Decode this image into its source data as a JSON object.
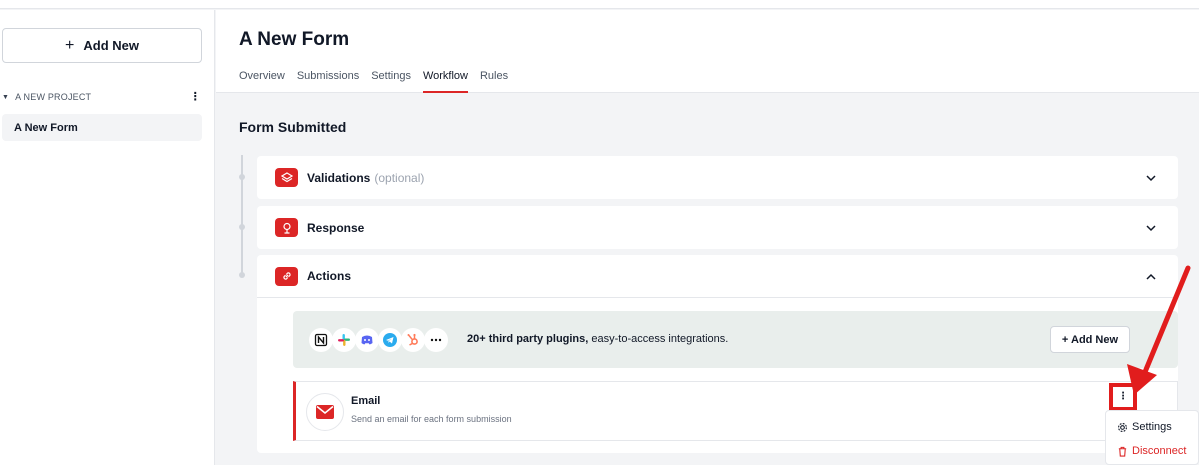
{
  "sidebar": {
    "add_new_label": "Add New",
    "project_name": "A NEW PROJECT",
    "forms": [
      {
        "label": "A New Form"
      }
    ]
  },
  "header": {
    "title": "A New Form",
    "tabs": [
      {
        "label": "Overview"
      },
      {
        "label": "Submissions"
      },
      {
        "label": "Settings"
      },
      {
        "label": "Workflow",
        "active": true
      },
      {
        "label": "Rules"
      }
    ]
  },
  "main": {
    "section_title": "Form Submitted",
    "panels": [
      {
        "label": "Validations",
        "optional": "(optional)"
      },
      {
        "label": "Response"
      },
      {
        "label": "Actions"
      }
    ],
    "plugins": {
      "icons": [
        "notion-icon",
        "slack-icon",
        "discord-icon",
        "telegram-icon",
        "hubspot-icon",
        "more-icon"
      ],
      "highlight": "20+ third party plugins,",
      "text": "easy-to-access integrations.",
      "add_label": "+ Add New"
    },
    "email_action": {
      "title": "Email",
      "description": "Send an email for each form submission"
    }
  },
  "context_menu": {
    "items": [
      {
        "label": "Settings",
        "icon": "gear-icon"
      },
      {
        "label": "Disconnect",
        "icon": "trash-icon"
      }
    ]
  },
  "colors": {
    "accent": "#dc2626",
    "annotation": "#e11d1d"
  }
}
